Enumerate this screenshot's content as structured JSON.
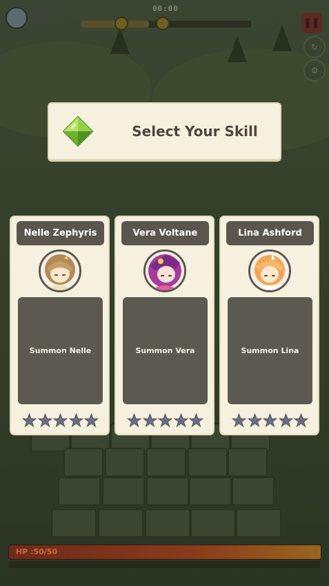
{
  "hud": {
    "timer": "00:00",
    "wave_progress": 0.4,
    "pause_icon": "pause-icon"
  },
  "player": {
    "hp_label": "HP :50/50",
    "hp_fraction": 1.0
  },
  "modal": {
    "title": "Select Your Skill",
    "icon": "green-gem-icon"
  },
  "skills": [
    {
      "name": "Nelle Zephyris",
      "summon_label": "Summon Nelle",
      "stars": 5,
      "portrait": "nelle-portrait",
      "hair": "#b08a5a",
      "accent": "#e8c98f"
    },
    {
      "name": "Vera Voltane",
      "summon_label": "Summon Vera",
      "stars": 5,
      "portrait": "vera-portrait",
      "hair": "#b03aa8",
      "accent": "#e25b9b"
    },
    {
      "name": "Lina Ashford",
      "summon_label": "Summon Lina",
      "stars": 5,
      "portrait": "lina-portrait",
      "hair": "#f2a655",
      "accent": "#f6c27a"
    }
  ],
  "colors": {
    "card_bg": "#f6f1de",
    "plate_bg": "#5a554d",
    "desc_bg": "#5c5a50",
    "star_fill": "#6a6f80"
  }
}
